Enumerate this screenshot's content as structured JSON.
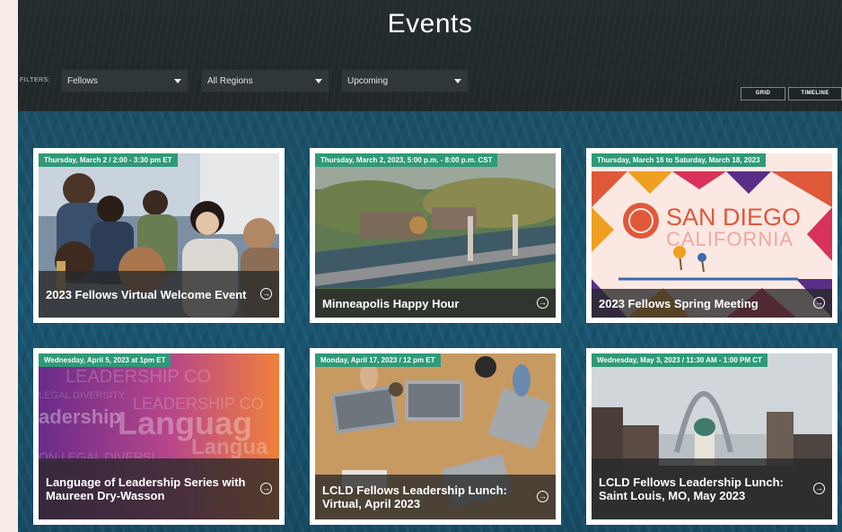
{
  "page": {
    "title": "Events"
  },
  "filters": {
    "label": "FILTERS:",
    "fellows": "Fellows",
    "regions": "All Regions",
    "timing": "Upcoming"
  },
  "views": {
    "grid": "GRID",
    "timeline": "TIMELINE"
  },
  "colors": {
    "accent": "#2f9a78",
    "bg_dark": "#1f2a2e",
    "caption_bg": "#333333"
  },
  "events": [
    {
      "date": "Thursday, March 2 / 2:00 - 3:30 pm ET",
      "title": "2023 Fellows Virtual Welcome Event"
    },
    {
      "date": "Thursday, March 2, 2023, 5:00 p.m. - 8:00 p.m. CST",
      "title": "Minneapolis Happy Hour"
    },
    {
      "date": "Thursday, March 16 to Saturday, March 18, 2023",
      "title": "2023 Fellows Spring Meeting",
      "image_text": {
        "line1": "SAN DIEGO",
        "line2": "CALIFORNIA"
      }
    },
    {
      "date": "Wednesday, April 5, 2023 at 1pm ET",
      "title": "Language of Leadership Series with Maureen Dry-Wasson",
      "image_text": {
        "w1": "LEADERSHIP CO",
        "w2": "LEGAL DIVERSITY",
        "w3": "LEADERSHIP CO",
        "w4": "adership",
        "w5": "Languag",
        "w6": "Langua",
        "w7": "ON LEGAL DIVERSI"
      }
    },
    {
      "date": "Monday, April 17, 2023 / 12 pm ET",
      "title": "LCLD Fellows Leadership Lunch: Virtual, April 2023"
    },
    {
      "date": "Wednesday, May 3, 2023 / 11:30 AM - 1:00 PM CT",
      "title": "LCLD Fellows Leadership Lunch: Saint Louis, MO, May 2023"
    }
  ]
}
